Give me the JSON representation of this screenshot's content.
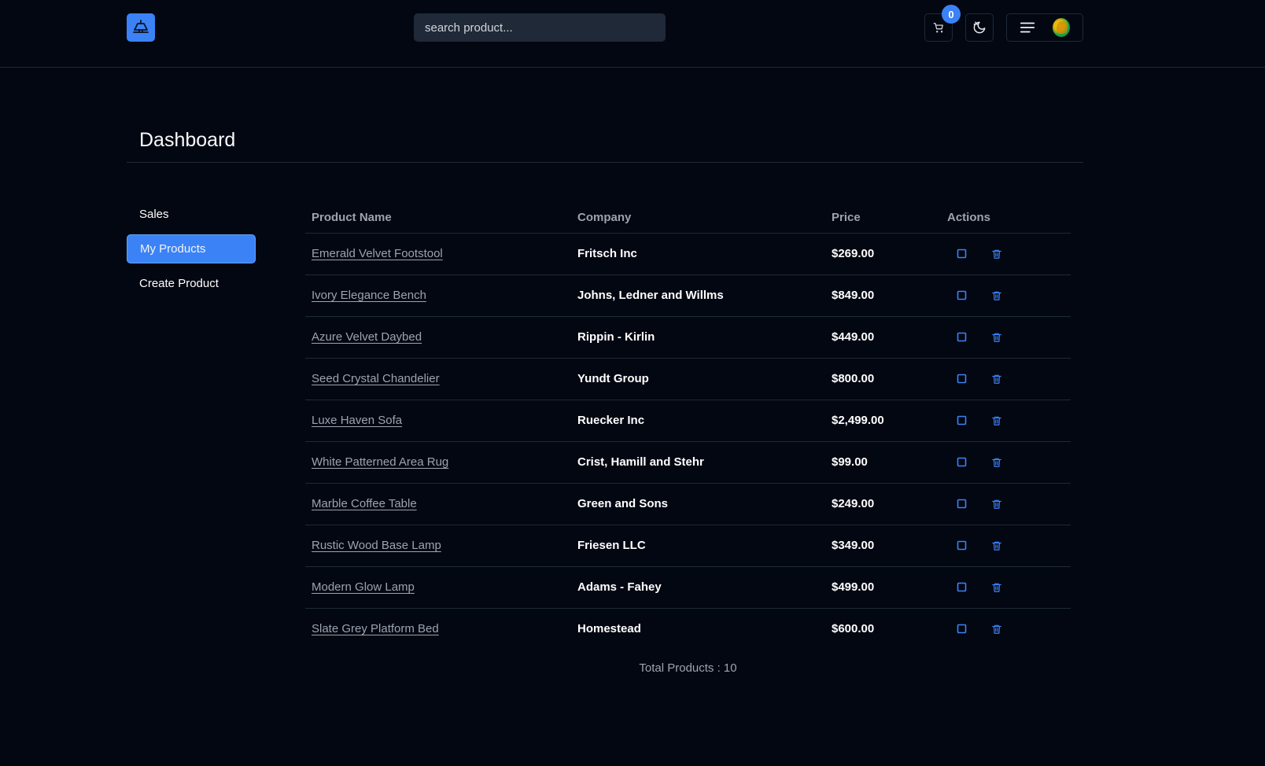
{
  "header": {
    "logo_icon": "lamp-icon",
    "search_placeholder": "search product...",
    "cart_count": "0",
    "cart_icon": "cart-icon",
    "theme_icon": "moon-stars-icon",
    "menu_icon": "menu-icon",
    "avatar": "avatar"
  },
  "page": {
    "title": "Dashboard"
  },
  "sidebar": {
    "items": [
      {
        "label": "Sales",
        "active": false
      },
      {
        "label": "My Products",
        "active": true
      },
      {
        "label": "Create Product",
        "active": false
      }
    ]
  },
  "table": {
    "columns": [
      "Product Name",
      "Company",
      "Price",
      "Actions"
    ],
    "rows": [
      {
        "name": "Emerald Velvet Footstool",
        "company": "Fritsch Inc",
        "price": "$269.00"
      },
      {
        "name": "Ivory Elegance Bench",
        "company": "Johns, Ledner and Willms",
        "price": "$849.00"
      },
      {
        "name": "Azure Velvet Daybed",
        "company": "Rippin - Kirlin",
        "price": "$449.00"
      },
      {
        "name": "Seed Crystal Chandelier",
        "company": "Yundt Group",
        "price": "$800.00"
      },
      {
        "name": "Luxe Haven Sofa",
        "company": "Ruecker Inc",
        "price": "$2,499.00"
      },
      {
        "name": "White Patterned Area Rug",
        "company": "Crist, Hamill and Stehr",
        "price": "$99.00"
      },
      {
        "name": "Marble Coffee Table",
        "company": "Green and Sons",
        "price": "$249.00"
      },
      {
        "name": "Rustic Wood Base Lamp",
        "company": "Friesen LLC",
        "price": "$349.00"
      },
      {
        "name": "Modern Glow Lamp",
        "company": "Adams - Fahey",
        "price": "$499.00"
      },
      {
        "name": "Slate Grey Platform Bed",
        "company": "Homestead",
        "price": "$600.00"
      }
    ],
    "action_icons": [
      "edit-icon",
      "trash-icon"
    ]
  },
  "footer": {
    "total_text": "Total Products : 10"
  },
  "colors": {
    "background": "#030712",
    "accent": "#3b82f6",
    "border": "#1f2937",
    "muted_text": "#9ca3af"
  }
}
